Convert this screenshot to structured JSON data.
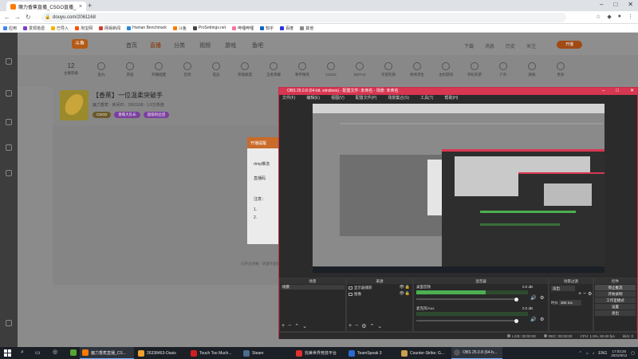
{
  "browser": {
    "tab_title": "魔力香蕉直播_CSGO直播_斗鱼直播",
    "url": "douyu.com/2061168",
    "bookmarks": [
      {
        "label": "应用",
        "color": "#4285f4"
      },
      {
        "label": "发现拾遗",
        "color": "#7b3fc4"
      },
      {
        "label": "已导入",
        "color": "#f4b400"
      },
      {
        "label": "淘宝网",
        "color": "#ff5000"
      },
      {
        "label": "网易新闻",
        "color": "#d43c33"
      },
      {
        "label": "Human Benchmark",
        "color": "#2b87d1"
      },
      {
        "label": "斗鱼",
        "color": "#ff7a00"
      },
      {
        "label": "ProSettings.net",
        "color": "#444444"
      },
      {
        "label": "哔哩哔哩",
        "color": "#fb7299"
      },
      {
        "label": "知乎",
        "color": "#0a66c2"
      },
      {
        "label": "百度",
        "color": "#2932e1"
      },
      {
        "label": "其他",
        "color": "#888888"
      }
    ]
  },
  "site": {
    "logo": "斗鱼",
    "nav": [
      "首页",
      "直播",
      "分类",
      "视频",
      "游戏",
      "鱼吧"
    ],
    "active_nav": "直播",
    "right_links": [
      "下载",
      "消息",
      "历史",
      "关注"
    ],
    "live_button": "开播",
    "level_num": "12",
    "categories": [
      "主播等级",
      "鱼丸",
      "贵族",
      "开播提醒",
      "签到",
      "电竞",
      "英雄联盟",
      "王者荣耀",
      "和平精英",
      "CSGO",
      "DOTA2",
      "守望先锋",
      "绝地求生",
      "主机游戏",
      "单机热游",
      "户外",
      "颜值",
      "更多"
    ],
    "room": {
      "title": "【香蕉】一位温柔突破手",
      "sub": "魔力香蕉 · 房间ID：2061168 · 1.5万热度",
      "tags": [
        {
          "label": "CSGO",
          "color": "#6b5a2a"
        },
        {
          "label": "香蕉大队长",
          "color": "#7b3fa0"
        },
        {
          "label": "超级粉丝团",
          "color": "#7b3fa0"
        }
      ]
    },
    "modal": {
      "head": "开播提醒",
      "lines": [
        "rtmp推流",
        "直播码",
        "注意：",
        "1.",
        "2."
      ]
    },
    "footer": "已开启弹幕 · 请遵守直播规范"
  },
  "obs": {
    "title": "OBS 25.0.8 (64-bit, windows) - 配置文件: 未命名 - 场景: 未命名",
    "menu": [
      "文件(F)",
      "编辑(E)",
      "视图(V)",
      "配置文件(P)",
      "场景集合(S)",
      "工具(T)",
      "帮助(H)"
    ],
    "docks": {
      "scenes": {
        "title": "场景",
        "items": [
          "场景"
        ]
      },
      "sources": {
        "title": "来源",
        "items": [
          "显示器捕获",
          "图像"
        ]
      },
      "mixer": {
        "title": "混音器",
        "channels": [
          {
            "name": "桌面音频",
            "db": "0.0 dB",
            "level": 0.62
          },
          {
            "name": "麦克风/Aux",
            "db": "0.0 dB",
            "level": 0.0
          }
        ]
      },
      "transitions": {
        "title": "场景过渡",
        "type": "淡出",
        "duration_label": "时长",
        "duration": "300 ms"
      },
      "controls": {
        "title": "控件",
        "buttons": [
          "停止推流",
          "开始录制",
          "工作室模式",
          "设置",
          "退出"
        ]
      }
    },
    "status": {
      "live": "LIVE: 00:00:00",
      "rec": "REC: 00:00:00",
      "cpu": "CPU: 1.9%, 60.00 fps",
      "kbps": "kb/s: 0"
    }
  },
  "taskbar": {
    "items": [
      {
        "label": "魔力香蕉直播_CS...",
        "color": "#ff7a00"
      },
      {
        "label": "26338463-Oasis",
        "color": "#f0a030"
      },
      {
        "label": "Touch Too Much...",
        "color": "#d02020"
      },
      {
        "label": "Steam",
        "color": "#1b2838"
      },
      {
        "label": "完美世界竞技平台",
        "color": "#e03030"
      },
      {
        "label": "TeamSpeak 3",
        "color": "#2a6bd0"
      },
      {
        "label": "Counter-Strike: G...",
        "color": "#c8a050"
      },
      {
        "label": "OBS 25.0.8 (64-b...",
        "color": "#333333"
      }
    ],
    "lang": "ENG",
    "time": "17:03:25",
    "date": "2021/9/12"
  }
}
